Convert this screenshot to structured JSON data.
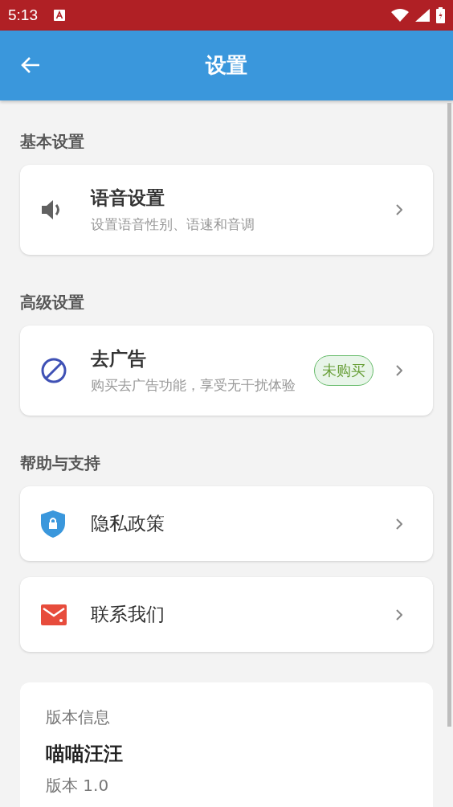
{
  "status_bar": {
    "time": "5:13"
  },
  "app_bar": {
    "title": "设置"
  },
  "sections": [
    {
      "header": "基本设置",
      "items": [
        {
          "title": "语音设置",
          "subtitle": "设置语音性别、语速和音调"
        }
      ]
    },
    {
      "header": "高级设置",
      "items": [
        {
          "title": "去广告",
          "subtitle": "购买去广告功能，享受无干扰体验",
          "badge": "未购买"
        }
      ]
    },
    {
      "header": "帮助与支持",
      "items": [
        {
          "title": "隐私政策"
        },
        {
          "title": "联系我们"
        }
      ]
    }
  ],
  "version_card": {
    "label": "版本信息",
    "app_name": "喵喵汪汪",
    "version": "版本 1.0"
  }
}
